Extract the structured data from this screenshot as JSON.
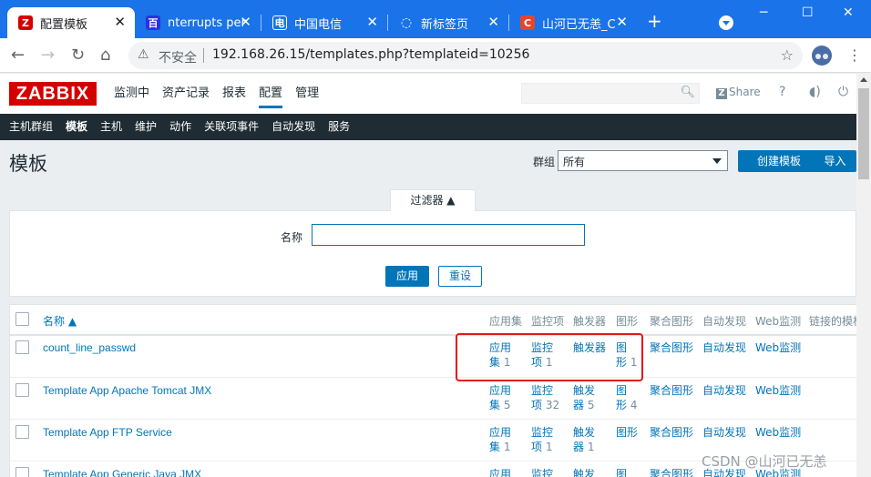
{
  "browser": {
    "tabs": [
      {
        "title": "配置模板",
        "fav": "Z",
        "color": "#d40000"
      },
      {
        "title": "nterrupts per",
        "fav": "百",
        "color": "#2932e1"
      },
      {
        "title": "中国电信",
        "fav": "电",
        "color": "#1a73e8"
      },
      {
        "title": "新标签页",
        "fav": "◌",
        "color": "#5f6368"
      },
      {
        "title": "山河已无恙_C",
        "fav": "C",
        "color": "#e8442c"
      }
    ],
    "new_tab": "+",
    "insecure": "不安全",
    "url": "192.168.26.15/templates.php?templateid=10256"
  },
  "zabbix": {
    "logo": "ZABBIX",
    "menu": [
      "监测中",
      "资产记录",
      "报表",
      "配置",
      "管理"
    ],
    "share": "Share",
    "help": "?",
    "subnav": [
      "主机群组",
      "模板",
      "主机",
      "维护",
      "动作",
      "关联项事件",
      "自动发现",
      "服务"
    ]
  },
  "page": {
    "title": "模板",
    "group_label": "群组",
    "group_value": "所有",
    "create_btn": "创建模板",
    "import_btn": "导入"
  },
  "filter": {
    "tab": "过滤器 ▲",
    "name_label": "名称",
    "name_value": "",
    "apply": "应用",
    "reset": "重设"
  },
  "table": {
    "headers": [
      "名称 ▲",
      "应用集",
      "监控项",
      "触发器",
      "图形",
      "聚合图形",
      "自动发现",
      "Web监测",
      "链接的模板"
    ],
    "rows": [
      {
        "name": "count_line_passwd",
        "app": [
          "应用",
          "集",
          "1"
        ],
        "items": [
          "监控",
          "项",
          "1"
        ],
        "triggers": [
          "触发器",
          "",
          ""
        ],
        "graphs": [
          "图",
          "形",
          "1"
        ],
        "screens": "聚合图形",
        "discovery": "自动发现",
        "web": "Web监测"
      },
      {
        "name": "Template App Apache Tomcat JMX",
        "app": [
          "应用",
          "集",
          "5"
        ],
        "items": [
          "监控",
          "项",
          "32"
        ],
        "triggers": [
          "触发",
          "器",
          "5"
        ],
        "graphs": [
          "图",
          "形",
          "4"
        ],
        "screens": "聚合图形",
        "discovery": "自动发现",
        "web": "Web监测"
      },
      {
        "name": "Template App FTP Service",
        "app": [
          "应用",
          "集",
          "1"
        ],
        "items": [
          "监控",
          "项",
          "1"
        ],
        "triggers": [
          "触发",
          "器",
          "1"
        ],
        "graphs": [
          "图形",
          "",
          ""
        ],
        "screens": "聚合图形",
        "discovery": "自动发现",
        "web": "Web监测"
      },
      {
        "name": "Template App Generic Java JMX",
        "app": [
          "应用",
          "",
          ""
        ],
        "items": [
          "监控",
          "",
          ""
        ],
        "triggers": [
          "触发",
          "",
          ""
        ],
        "graphs": [
          "图",
          "",
          ""
        ],
        "screens": "聚合图形",
        "discovery": "自动发现",
        "web": "Web监测"
      }
    ]
  },
  "watermark": "CSDN @山河已无恙"
}
